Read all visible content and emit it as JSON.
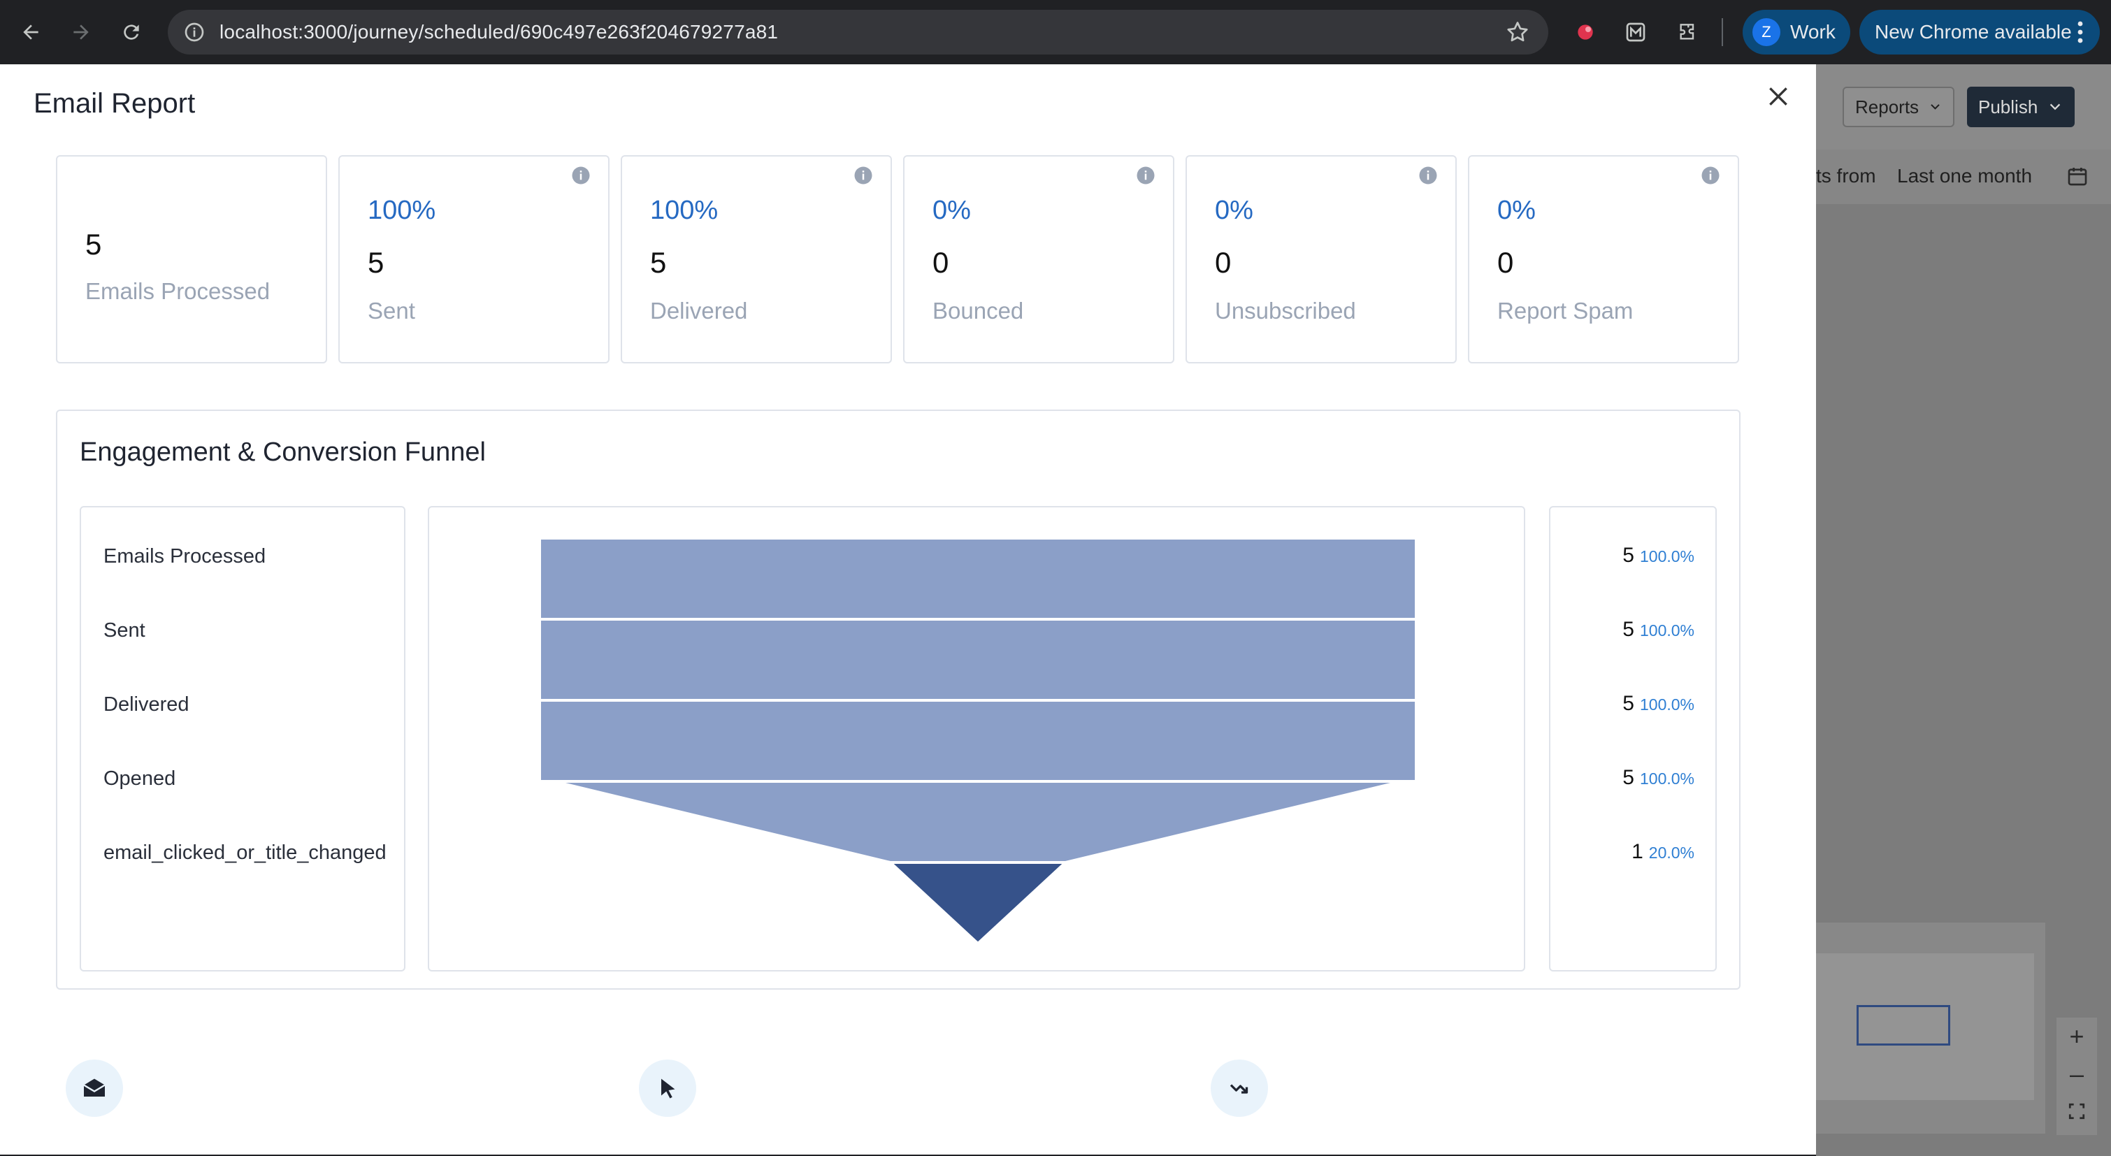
{
  "browser": {
    "url": "localhost:3000/journey/scheduled/690c497e263f204679277a81",
    "profile_initial": "Z",
    "profile_label": "Work",
    "update_label": "New Chrome available"
  },
  "background": {
    "reports_label": "Reports",
    "publish_label": "Publish",
    "filter_text": "ts from",
    "filter_range": "Last one month",
    "zoom_in": "+",
    "zoom_out": "–"
  },
  "modal": {
    "title": "Email Report",
    "stats": [
      {
        "value": "5",
        "label": "Emails Processed"
      },
      {
        "percent": "100%",
        "value": "5",
        "label": "Sent"
      },
      {
        "percent": "100%",
        "value": "5",
        "label": "Delivered"
      },
      {
        "percent": "0%",
        "value": "0",
        "label": "Bounced"
      },
      {
        "percent": "0%",
        "value": "0",
        "label": "Unsubscribed"
      },
      {
        "percent": "0%",
        "value": "0",
        "label": "Report Spam"
      }
    ],
    "funnel_title": "Engagement & Conversion Funnel"
  },
  "chart_data": {
    "type": "funnel",
    "categories": [
      "Emails Processed",
      "Sent",
      "Delivered",
      "Opened",
      "email_clicked_or_title_changed"
    ],
    "values": [
      5,
      5,
      5,
      5,
      1
    ],
    "percent_labels": [
      "100.0%",
      "100.0%",
      "100.0%",
      "100.0%",
      "20.0%"
    ],
    "colors": [
      "#8b9fc8",
      "#8b9fc8",
      "#8b9fc8",
      "#8b9fc8",
      "#36528a"
    ]
  },
  "colors": {
    "accent_blue": "#2569c2",
    "funnel_light": "#8b9fc8",
    "funnel_dark": "#36528a"
  },
  "icons": {
    "bottom": [
      "email-open-icon",
      "cursor-click-icon",
      "conversion-icon"
    ]
  }
}
